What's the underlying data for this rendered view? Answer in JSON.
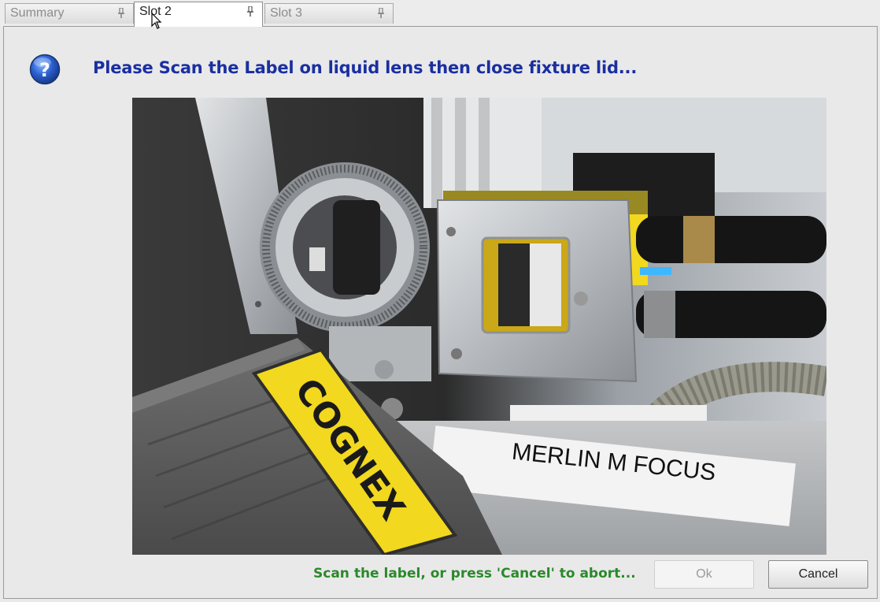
{
  "tabs": [
    {
      "label": "Summary",
      "active": false
    },
    {
      "label": "Slot 2",
      "active": true
    },
    {
      "label": "Slot 3",
      "active": false
    }
  ],
  "dialog": {
    "icon": "question-icon",
    "prompt": "Please Scan the Label on liquid lens then close fixture lid...",
    "status": "Scan the label, or press 'Cancel' to abort...",
    "ok_label": "Ok",
    "cancel_label": "Cancel"
  },
  "photo": {
    "scanner_brand": "COGNEX",
    "fixture_label": "MERLIN M FOCUS"
  },
  "colors": {
    "prompt": "#1a2fa0",
    "status": "#2a8a2a",
    "scanner_yellow": "#f2d81e"
  }
}
